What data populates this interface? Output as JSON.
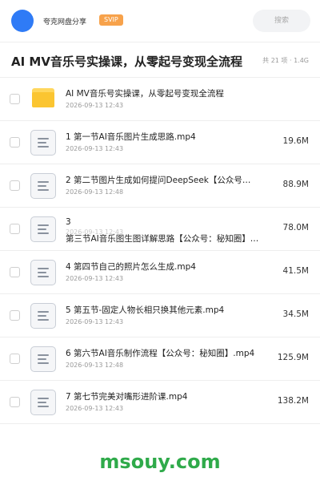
{
  "header": {
    "user_name": "夸克网盘分享",
    "badge": "SVIP",
    "search_placeholder": "搜索",
    "avatar_color": "#2f7bf6"
  },
  "title_bar": {
    "title": "AI MV音乐号实操课，从零起号变现全流程",
    "meta": "共 21 项 · 1.4G"
  },
  "items": [
    {
      "type": "folder",
      "name": "AI MV音乐号实操课，从零起号变现全流程",
      "date": "2026-09-13 12:43",
      "size": ""
    },
    {
      "type": "file",
      "name": "1 第一节AI音乐图片生成思路.mp4",
      "date": "2026-09-13 12:43",
      "size": "19.6M"
    },
    {
      "type": "file",
      "name": "2 第二节图片生成如何提问DeepSeek【公众号…",
      "date": "2026-09-13 12:48",
      "size": "88.9M"
    },
    {
      "type": "file",
      "name_line1": "3",
      "name_line2": "第三节AI音乐图生图详解思路【公众号：秘知圈】…",
      "date": "2026-09-13 12:43",
      "size": "78.0M"
    },
    {
      "type": "file",
      "name": "4 第四节自己的照片怎么生成.mp4",
      "date": "2026-09-13 12:43",
      "size": "41.5M"
    },
    {
      "type": "file",
      "name": "5 第五节-固定人物长相只换其他元素.mp4",
      "date": "2026-09-13 12:43",
      "size": "34.5M"
    },
    {
      "type": "file",
      "name": "6 第六节AI音乐制作流程【公众号：秘知圈】.mp4",
      "date": "2026-09-13 12:48",
      "size": "125.9M"
    },
    {
      "type": "file",
      "name": "7 第七节完美对嘴形进阶课.mp4",
      "date": "2026-09-13 12:43",
      "size": "138.2M"
    }
  ],
  "watermark": "msouy.com",
  "colors": {
    "accent_blue": "#2f7bf6",
    "svip_orange": "#f7a24b",
    "folder_yellow": "#fbc531",
    "watermark_green": "#2faa4a"
  }
}
